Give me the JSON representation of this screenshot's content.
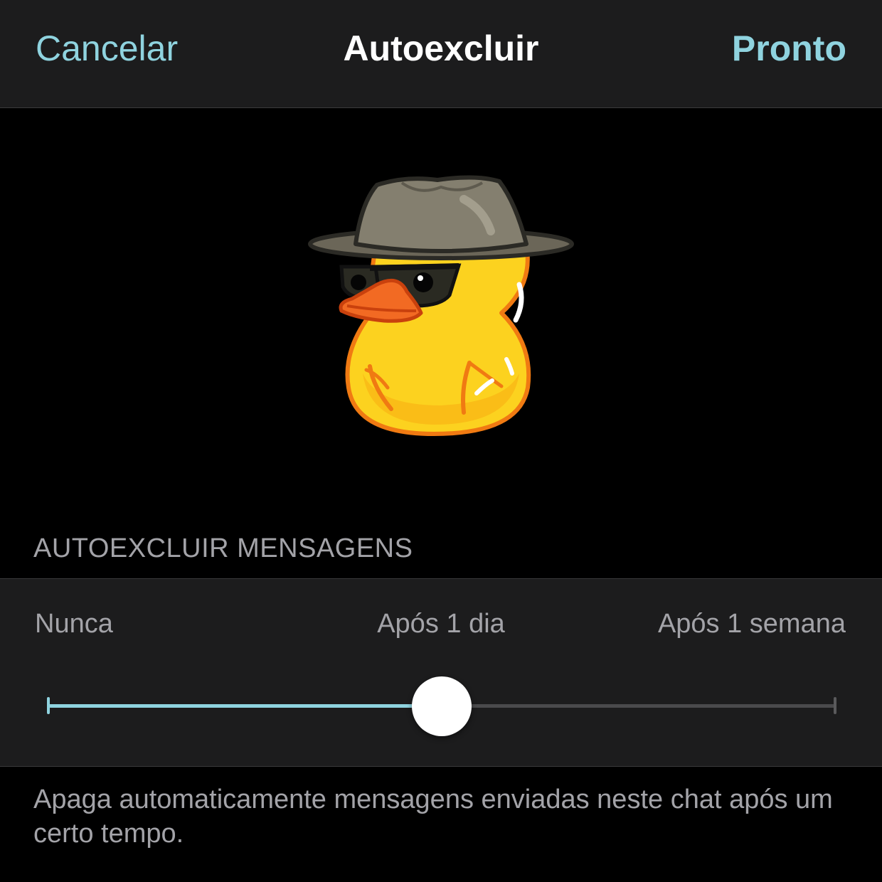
{
  "navbar": {
    "cancel_label": "Cancelar",
    "title": "Autoexcluir",
    "done_label": "Pronto"
  },
  "sticker": {
    "icon": "duck-with-hat-and-sunglasses-icon"
  },
  "section": {
    "header": "AUTOEXCLUIR MENSAGENS"
  },
  "slider": {
    "options": [
      "Nunca",
      "Após 1 dia",
      "Após 1 semana"
    ],
    "selected_label": "Após 1 dia",
    "selected_fraction": 0.5
  },
  "footnote": {
    "text": "Apaga automaticamente mensagens enviadas neste chat após um certo tempo."
  },
  "colors": {
    "accent": "#8fd3df",
    "background": "#000000",
    "card": "#1c1c1d",
    "secondary_text": "#a3a3a8"
  }
}
